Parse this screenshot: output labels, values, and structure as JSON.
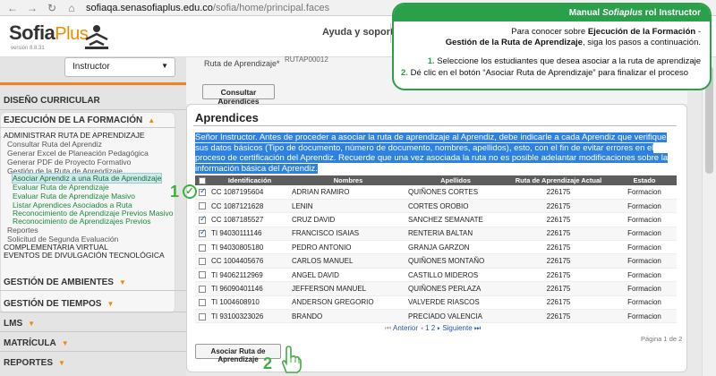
{
  "browser": {
    "url_host": "sofiaqa.senasofiaplus.edu.co",
    "url_path": "/sofia/home/principal.faces"
  },
  "header": {
    "logo_main": "Sofia",
    "logo_plus": "Plus",
    "logo_version": "versión 8.8.31",
    "help_link": "Ayuda y soporte"
  },
  "sidebar": {
    "role": "Instructor",
    "sections": [
      {
        "label": "DISEÑO CURRICULAR"
      },
      {
        "label": "EJECUCIÓN DE LA FORMACIÓN"
      },
      {
        "label": "GESTIÓN DE AMBIENTES"
      },
      {
        "label": "GESTIÓN DE TIEMPOS"
      },
      {
        "label": "LMS"
      },
      {
        "label": "MATRÍCULA"
      },
      {
        "label": "REPORTES"
      }
    ],
    "menu": {
      "admin_ruta": "ADMINISTRAR RUTA DE APRENDIZAJE",
      "consultar_ruta": "Consultar Ruta del Aprendiz",
      "generar_excel": "Generar Excel de Planeación Pedagógica",
      "generar_pdf": "Generar PDF de Proyecto Formativo",
      "gestion_ruta": "Gestión de la Ruta de Aprendizaje",
      "sub_asociar": "Asociar Aprendiz a una Ruta de Aprendizaje",
      "sub_evaluar": "Evaluar Ruta de Aprendizaje",
      "sub_evaluar_masivo": "Evaluar Ruta de Aprendizaje Masivo",
      "sub_listar": "Listar Aprendices Asociados a Ruta",
      "sub_reconocimiento_masivo": "Reconocimiento de Aprendizaje Previos Masivo",
      "sub_reconocimiento": "Reconocimiento de Aprendizajes Previos",
      "reportes": "Reportes",
      "solicitud": "Solicitud de Segunda Evaluación",
      "complementaria": "COMPLEMENTARIA VIRTUAL",
      "eventos": "EVENTOS DE DIVULGACIÓN TECNOLÓGICA"
    }
  },
  "form": {
    "route_label": "Ruta de Aprendizaje*",
    "route_value": "RUTAP00012",
    "consultar_button": "Consultar Aprendices"
  },
  "content": {
    "title": "Aprendices",
    "notice": "Señor Instructor. Antes de proceder a asociar la ruta de aprendizaje al Aprendiz, debe indicarle a cada Aprendiz que verifique sus datos básicos (Tipo de documento, número de documento, nombres, apellidos), esto, con el fin de evitar errores en el proceso de certificación del Aprendiz. Recuerde que una vez asociada la ruta no es posible adelantar modificaciones sobre la información básica del Aprendiz.",
    "columns": [
      "",
      "Identificación",
      "Nombres",
      "Apellidos",
      "Ruta de Aprendizaje Actual",
      "Estado"
    ],
    "rows": [
      {
        "checked": true,
        "id": "CC 1087195604",
        "names": "ADRIAN RAMIRO",
        "surnames": "QUIÑONES CORTES",
        "route": "226175",
        "state": "Formacion"
      },
      {
        "checked": false,
        "id": "CC 1087121628",
        "names": "LENIN",
        "surnames": "CORTES OROBIO",
        "route": "226175",
        "state": "Formacion"
      },
      {
        "checked": true,
        "id": "CC 1087185527",
        "names": "CRUZ DAVID",
        "surnames": "SANCHEZ SEMANATE",
        "route": "226175",
        "state": "Formacion"
      },
      {
        "checked": true,
        "id": "TI 94030111146",
        "names": "FRANCISCO ISAIAS",
        "surnames": "RENTERIA BALTAN",
        "route": "226175",
        "state": "Formacion"
      },
      {
        "checked": false,
        "id": "TI 94030805180",
        "names": "PEDRO ANTONIO",
        "surnames": "GRANJA GARZON",
        "route": "226175",
        "state": "Formacion"
      },
      {
        "checked": false,
        "id": "CC 1004405676",
        "names": "CARLOS MANUEL",
        "surnames": "QUIÑONES MONTAÑO",
        "route": "226175",
        "state": "Formacion"
      },
      {
        "checked": false,
        "id": "TI 94062112969",
        "names": "ANGEL DAVID",
        "surnames": "CASTILLO MIDEROS",
        "route": "226175",
        "state": "Formacion"
      },
      {
        "checked": false,
        "id": "TI 96090401146",
        "names": "JEFFERSON MANUEL",
        "surnames": "QUIÑONES PERLAZA",
        "route": "226175",
        "state": "Formacion"
      },
      {
        "checked": false,
        "id": "TI 1004608910",
        "names": "ANDERSON GREGORIO",
        "surnames": "VALVERDE RIASCOS",
        "route": "226175",
        "state": "Formacion"
      },
      {
        "checked": false,
        "id": "TI 93100323026",
        "names": "BRANDO",
        "surnames": "PRECIADO VALENCIA",
        "route": "226175",
        "state": "Formacion"
      }
    ],
    "pager_prev": "Anterior",
    "pager_pages": "1 2",
    "pager_next": "Siguiente",
    "page_info": "Página 1 de 2",
    "asociar_button": "Asociar Ruta de Aprendizaje"
  },
  "instructions": {
    "title_prefix": "Manual ",
    "title_em": "Sofiaplus",
    "title_suffix": " rol Instructor",
    "line1": "Para conocer sobre ",
    "line1_bold": "Ejecución de la Formación",
    "line1_end": " -",
    "line2_bold": "Gestión de la Ruta de Aprendizaje",
    "line2_end": ", siga los pasos a continuación.",
    "step1_num": "1.",
    "step1": "Seleccione los estudiantes que desea asociar a la ruta de aprendizaje",
    "step2_num": "2.",
    "step2": "Dé clic en el botón “Asociar Ruta de Aprendizaje” para finalizar el proceso"
  },
  "annotations": {
    "mark1": "1",
    "mark2": "2"
  },
  "colors": {
    "accent_green": "#2aa04a",
    "accent_orange": "#f58220",
    "highlight_blue": "#2d81e0"
  }
}
